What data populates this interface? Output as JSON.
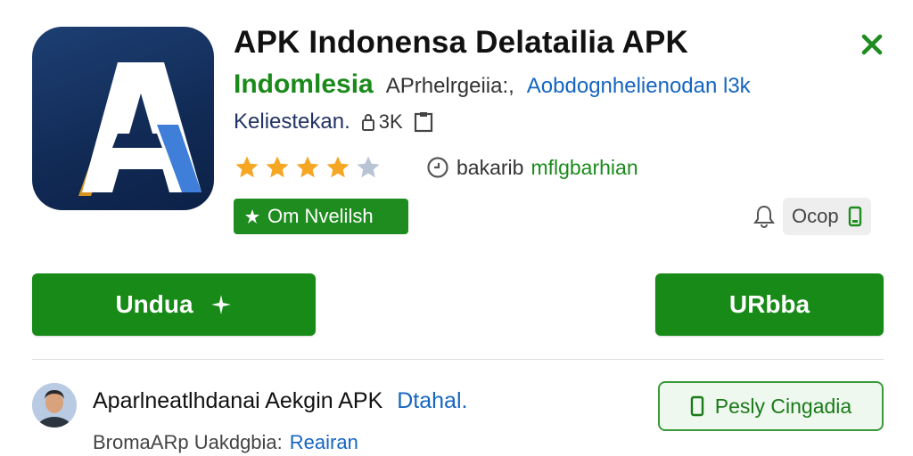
{
  "app": {
    "title": "APK Indonensa Delatailia APK",
    "developer": "Indomlesia",
    "subtitle_text": "APrhelrgeiia:,",
    "subtitle_link": "Aobdognhelienodan l3k",
    "meta_label": "Keliestekan.",
    "meta_count": "3K",
    "rating_stars": 4,
    "rating_max": 5,
    "rating_side_dark": "bakarib",
    "rating_side_green": "mflgbarhian",
    "badge_label": "Om Nvelilsh",
    "scope_label": "Ocop",
    "icon_names": {
      "close": "close-icon",
      "lock": "lock-icon",
      "clipboard": "clipboard-icon",
      "clock": "clock-icon",
      "leaf": "leaf-icon",
      "bell": "bell-icon",
      "phone": "phone-icon",
      "plus": "plus-icon"
    }
  },
  "actions": {
    "download_label": "Undua",
    "secondary_label": "URbba"
  },
  "related": {
    "title": "Aparlneatlhdanai Aekgin APK",
    "title_link": "Dtahal.",
    "subtitle_text": "BromaARp Uakdgbia:",
    "subtitle_link": "Reairan",
    "outline_button_label": "Pesly Cingadia"
  },
  "colors": {
    "accent_green": "#178a17",
    "link_blue": "#1565c0",
    "star_gold": "#f5a623",
    "star_empty": "#b8c4d6",
    "icon_navy": "#112a55"
  }
}
